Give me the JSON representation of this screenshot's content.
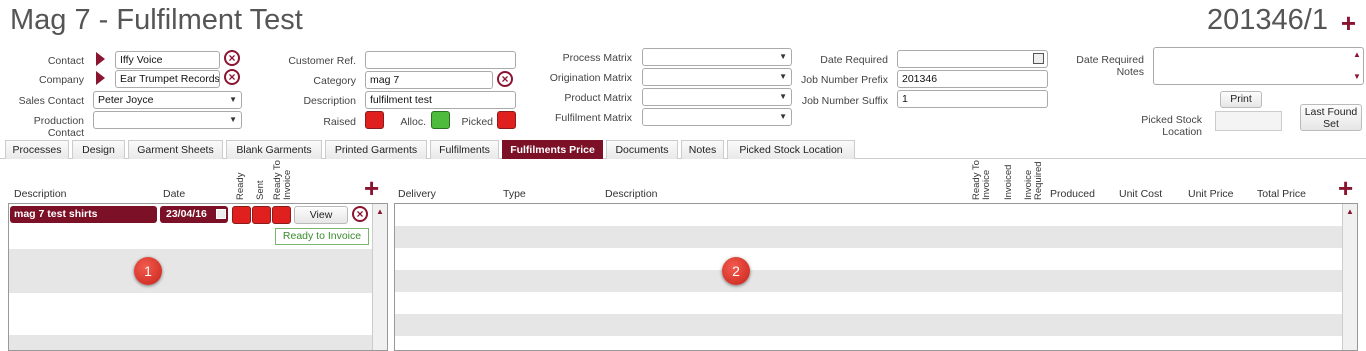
{
  "header": {
    "title": "Mag 7 - Fulfilment Test",
    "job_number": "201346/1",
    "add_icon": "plus-icon"
  },
  "form": {
    "contact_label": "Contact",
    "contact_value": "Iffy Voice",
    "company_label": "Company",
    "company_value": "Ear Trumpet Records",
    "sales_contact_label": "Sales Contact",
    "sales_contact_value": "Peter Joyce",
    "production_contact_label": "Production Contact",
    "production_contact_value": "",
    "customer_ref_label": "Customer Ref.",
    "customer_ref_value": "",
    "category_label": "Category",
    "category_value": "mag 7",
    "description_label": "Description",
    "description_value": "fulfilment test",
    "raised_label": "Raised",
    "alloc_label": "Alloc.",
    "picked_label": "Picked",
    "process_matrix_label": "Process Matrix",
    "origination_matrix_label": "Origination Matrix",
    "product_matrix_label": "Product Matrix",
    "fulfilment_matrix_label": "Fulfilment Matrix",
    "date_required_label": "Date Required",
    "date_required_value": "",
    "job_number_prefix_label": "Job Number Prefix",
    "job_number_prefix_value": "201346",
    "job_number_suffix_label": "Job Number Suffix",
    "job_number_suffix_value": "1",
    "date_required_notes_label": "Date Required Notes",
    "print_button": "Print",
    "picked_stock_location_label": "Picked Stock Location",
    "last_found_set_button": "Last Found Set",
    "status_colors": {
      "raised": "#e0201f",
      "alloc": "#4fbb3d",
      "picked": "#e0201f"
    }
  },
  "tabs": [
    "Processes",
    "Design",
    "Garment Sheets",
    "Blank Garments",
    "Printed Garments",
    "Fulfilments",
    "Fulfilments Price",
    "Documents",
    "Notes",
    "Picked Stock Location"
  ],
  "active_tab": "Fulfilments Price",
  "left_panel": {
    "headers": {
      "description": "Description",
      "date": "Date",
      "ready": "Ready",
      "sent": "Sent",
      "ready_to_invoice": "Ready To Invoice"
    },
    "rows": [
      {
        "description": "mag 7 test shirts",
        "date": "23/04/16",
        "view_button": "View",
        "badge": "Ready to Invoice"
      }
    ],
    "marker": "1"
  },
  "right_panel": {
    "headers": {
      "delivery": "Delivery",
      "type": "Type",
      "description": "Description",
      "ready_to_invoice": "Ready To Invoice",
      "invoiced": "Invoiced",
      "invoice_required": "Invoice Required",
      "produced": "Produced",
      "unit_cost": "Unit Cost",
      "unit_price": "Unit Price",
      "total_price": "Total Price"
    },
    "marker": "2"
  },
  "theme": {
    "accent": "#7b1027",
    "brand_red": "#8a1530"
  }
}
